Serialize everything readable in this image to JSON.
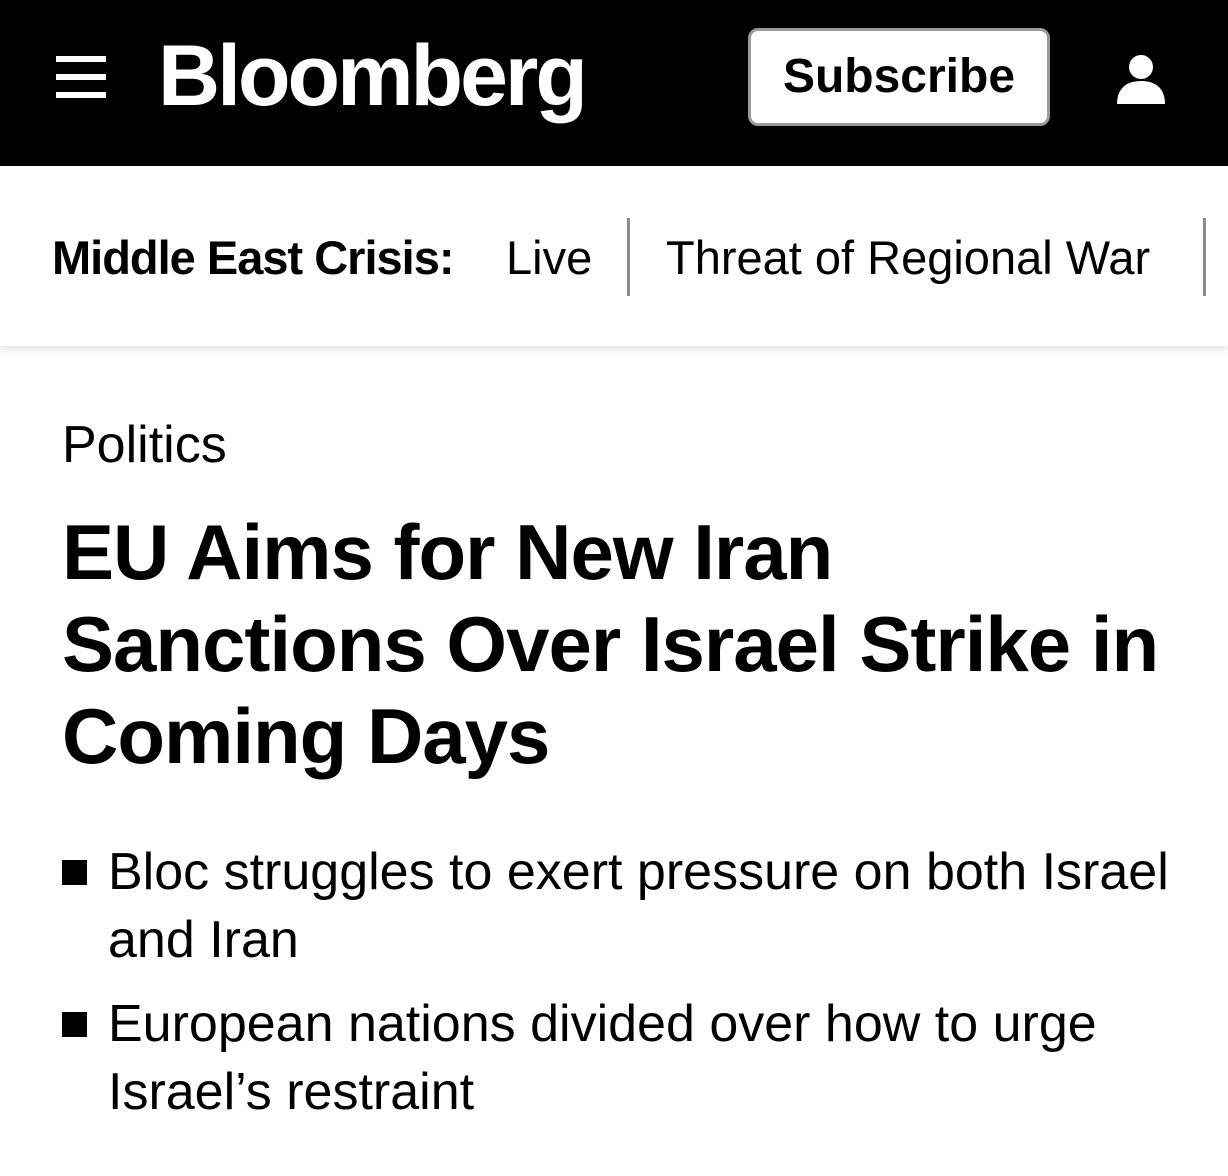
{
  "header": {
    "brand": "Bloomberg",
    "subscribe_label": "Subscribe",
    "menu_icon": "hamburger-menu-icon",
    "account_icon": "user-account-icon",
    "colors": {
      "bar_background": "#000000",
      "brand_text": "#ffffff",
      "button_background": "#ffffff",
      "button_border": "#9a9a9a"
    }
  },
  "crisis_nav": {
    "label": "Middle East Crisis:",
    "links": [
      {
        "label": "Live"
      },
      {
        "label": "Threat of Regional War"
      }
    ]
  },
  "article": {
    "section": "Politics",
    "headline": "EU Aims for New Iran Sanctions Over Israel Strike in Coming Days",
    "bullets": [
      {
        "text": "Bloc struggles to exert pressure on both Israel and Iran"
      },
      {
        "text": "European nations divided over how to urge Israel’s restraint"
      }
    ]
  }
}
